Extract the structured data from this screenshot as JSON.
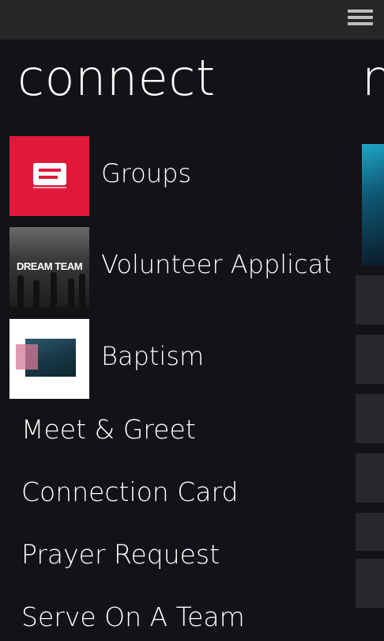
{
  "header": {
    "menu_icon": "hamburger-menu-icon"
  },
  "page": {
    "title": "connect",
    "next_section_title": "n"
  },
  "tile_items": [
    {
      "label": "Groups",
      "thumb": "groups-logo"
    },
    {
      "label": "Volunteer Applicati",
      "thumb": "dream-team-photo",
      "thumb_text": "DREAM TEAM"
    },
    {
      "label": "Baptism",
      "thumb": "baptism-water-photo"
    }
  ],
  "text_items": [
    {
      "label": "Meet & Greet"
    },
    {
      "label": "Connection Card"
    },
    {
      "label": "Prayer Request"
    },
    {
      "label": "Serve On A Team"
    }
  ],
  "colors": {
    "background": "#121316",
    "topbar": "#262628",
    "groups_red": "#e0193a",
    "text": "#ffffff"
  }
}
